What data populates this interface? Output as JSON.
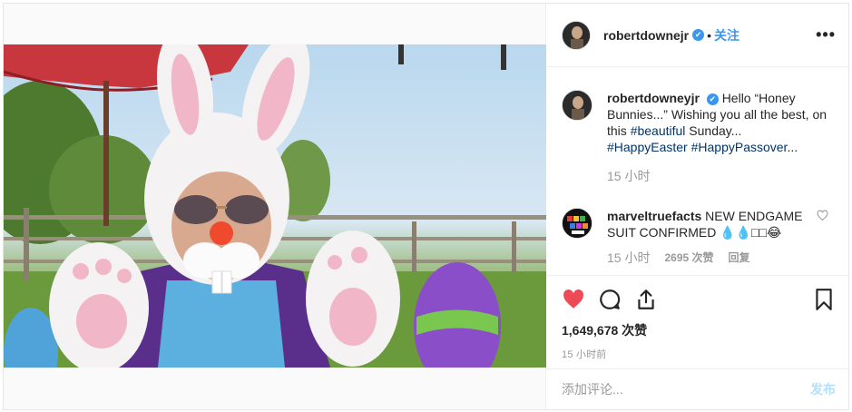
{
  "header": {
    "username": "robertdownejr",
    "verified_mark": "✔",
    "separator": "•",
    "follow_label": "关注",
    "more_label": "•••"
  },
  "caption": {
    "username": "robertdowneyjr",
    "text_a": "Hello “Honey Bunnies...” Wishing you all the best, on this ",
    "hashtag1": "#beautiful",
    "text_b": " Sunday...",
    "hashtag2": "#HappyEaster",
    "hashtag3": "#HappyPassover",
    "text_c": "...",
    "time": "15 小时"
  },
  "comment": {
    "username": "marveltruefacts",
    "text": "NEW ENDGAME SUIT CONFIRMED 💧💧□□😂",
    "time": "15 小时",
    "likes": "2695 次赞",
    "reply_label": "回复"
  },
  "actions": {
    "likes_count": "1,649,678 次赞",
    "post_time": "15 小时前"
  },
  "add_comment": {
    "placeholder": "添加评论...",
    "post_label": "发布"
  },
  "colors": {
    "like_red": "#ed4956",
    "link_blue": "#3897f0",
    "hashtag": "#003569",
    "muted": "#999999"
  }
}
